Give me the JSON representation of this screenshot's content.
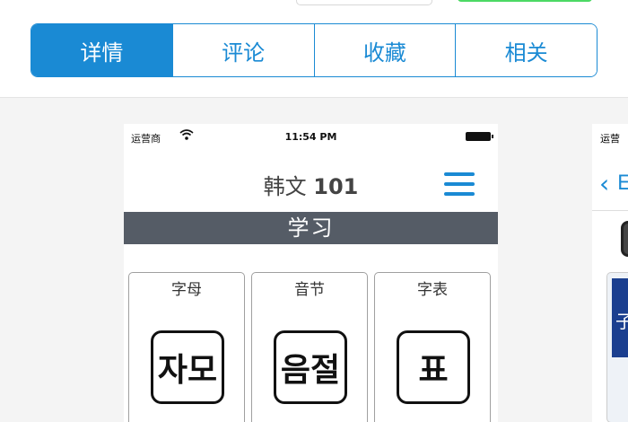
{
  "tabs": [
    {
      "label": "详情",
      "active": true
    },
    {
      "label": "评论",
      "active": false
    },
    {
      "label": "收藏",
      "active": false
    },
    {
      "label": "相关",
      "active": false
    }
  ],
  "screenshot1": {
    "status": {
      "carrier": "运营商",
      "time": "11:54 PM"
    },
    "title_text": "韩文",
    "title_num": "101",
    "section": "学习",
    "cards": [
      {
        "label": "字母",
        "key": "자모"
      },
      {
        "label": "音节",
        "key": "음절"
      },
      {
        "label": "字表",
        "key": "표"
      }
    ]
  },
  "screenshot2": {
    "status": {
      "carrier": "运营"
    },
    "back_label": "E",
    "card_glyph": "子"
  },
  "colors": {
    "accent": "#1a8ad4",
    "section_bar": "#555c66",
    "switch_green": "#4cd964"
  }
}
